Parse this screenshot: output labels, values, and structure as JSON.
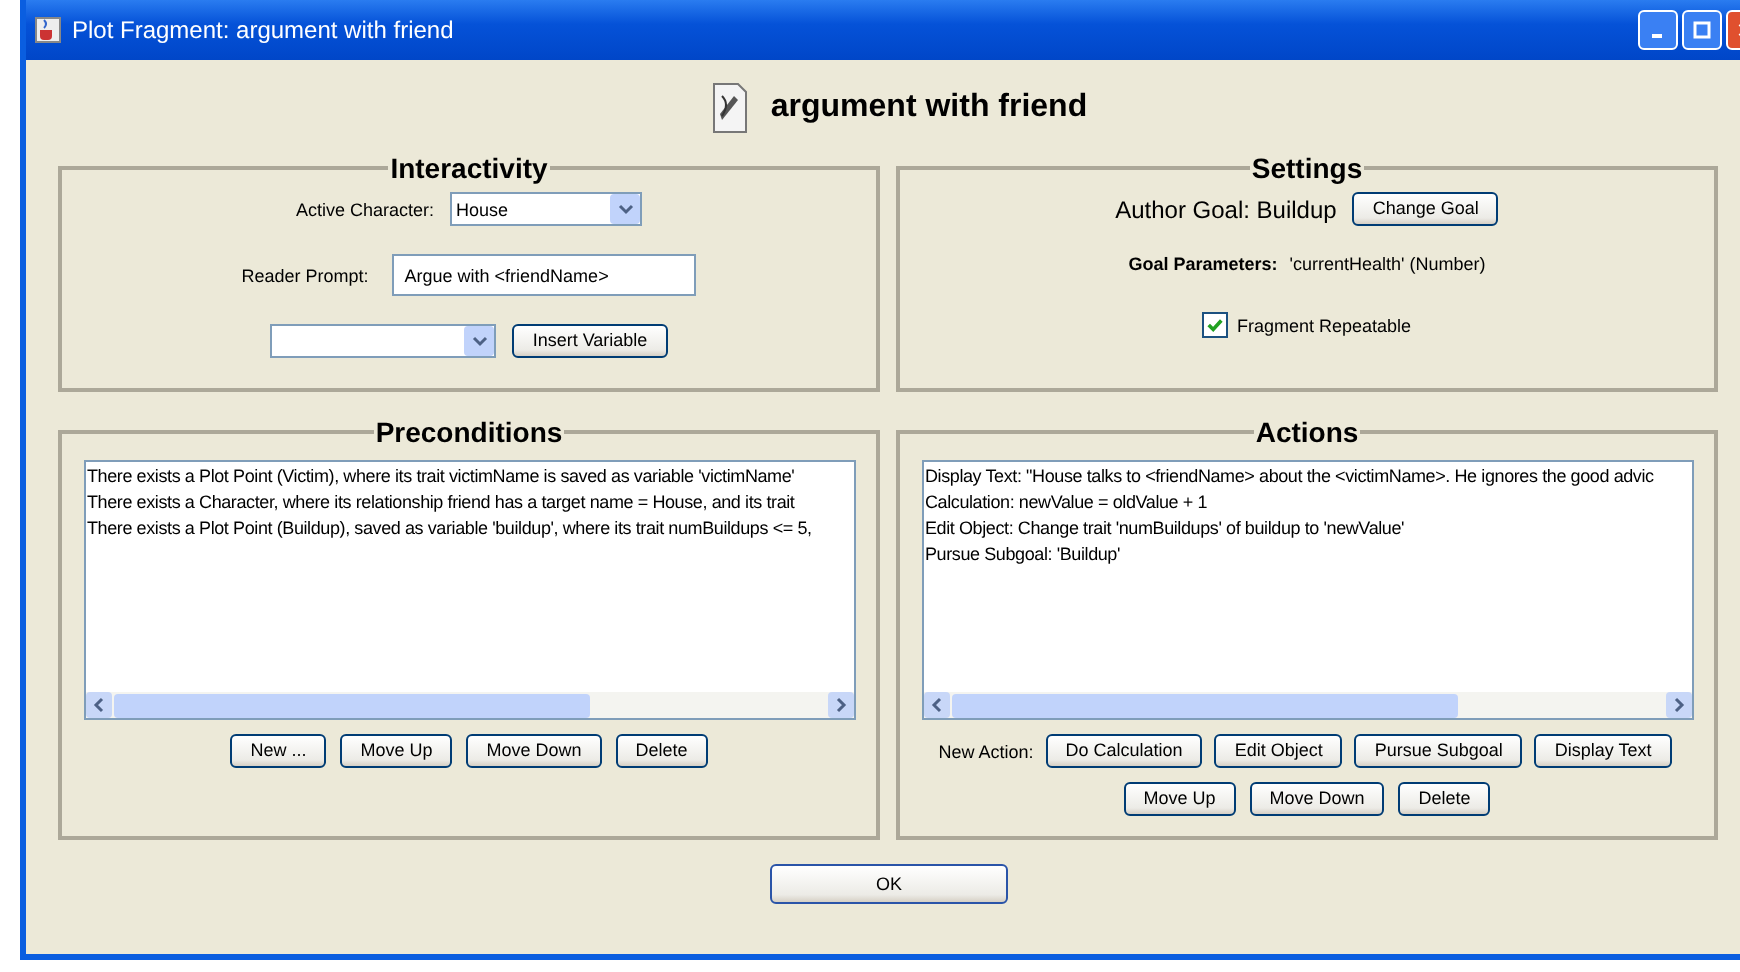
{
  "window": {
    "title": "Plot Fragment: argument with friend"
  },
  "header": {
    "title": "argument with friend"
  },
  "interactivity": {
    "title": "Interactivity",
    "active_character_label": "Active Character:",
    "active_character_value": "House",
    "reader_prompt_label": "Reader Prompt:",
    "reader_prompt_value": "Argue with <friendName>",
    "insert_button": "Insert Variable"
  },
  "settings": {
    "title": "Settings",
    "author_goal": "Author Goal: Buildup",
    "change_goal_button": "Change Goal",
    "goal_parameters_label": "Goal Parameters:",
    "goal_parameters_value": "'currentHealth' (Number)",
    "repeatable": {
      "label": "Fragment Repeatable",
      "checked": true
    }
  },
  "preconditions": {
    "title": "Preconditions",
    "items": [
      "There exists a Plot Point (Victim), where its trait victimName is saved as variable 'victimName'",
      "There exists a Character, where its relationship friend has a target name = House, and its trait",
      "There exists a Plot Point (Buildup), saved as variable 'buildup', where its trait numBuildups <= 5,"
    ],
    "buttons": [
      "New ...",
      "Move Up",
      "Move Down",
      "Delete"
    ]
  },
  "actions": {
    "title": "Actions",
    "items": [
      "Display Text: \"House talks to <friendName> about the <victimName>. He ignores the good advic",
      "Calculation: newValue = oldValue + 1",
      "Edit Object: Change trait 'numBuildups' of buildup to 'newValue'",
      "Pursue Subgoal: 'Buildup'"
    ],
    "new_action_label": "New Action:",
    "new_buttons": [
      "Do Calculation",
      "Edit Object",
      "Pursue Subgoal",
      "Display Text"
    ],
    "buttons": [
      "Move Up",
      "Move Down",
      "Delete"
    ]
  },
  "ok_button": "OK"
}
